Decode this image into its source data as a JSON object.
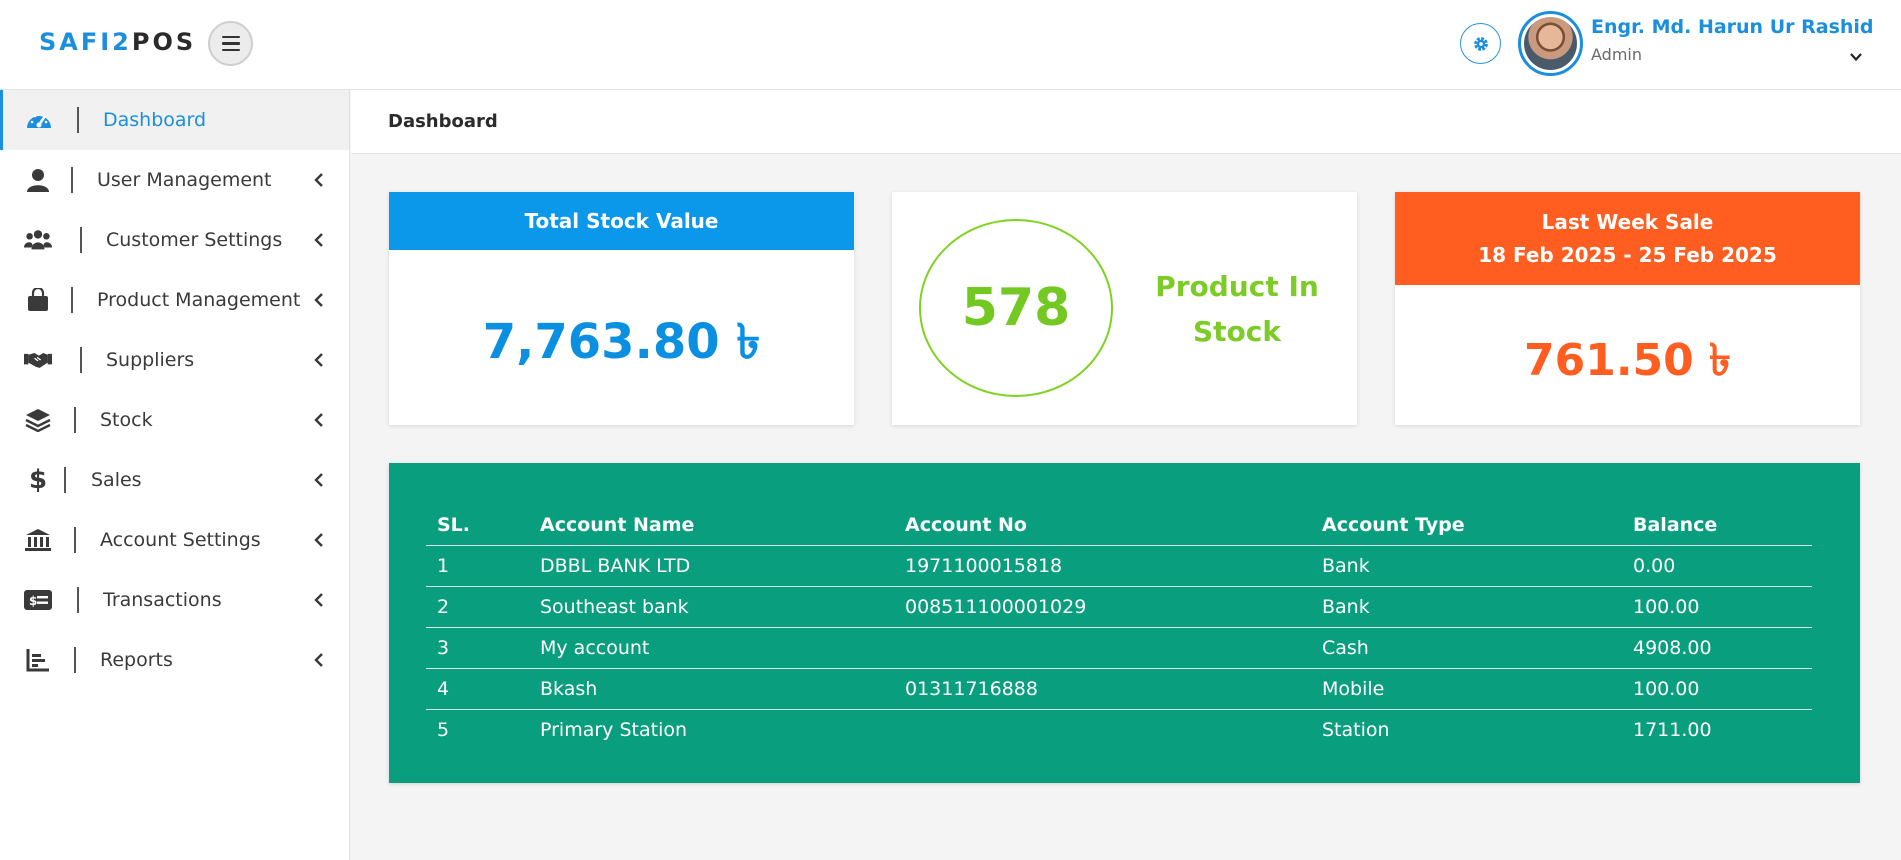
{
  "header": {
    "logo_part1": "SAFI2",
    "logo_part2": "POS",
    "user_name": "Engr. Md. Harun Ur Rashid",
    "user_role": "Admin"
  },
  "sidebar": {
    "items": [
      {
        "label": "Dashboard",
        "icon": "tachometer-icon",
        "active": true
      },
      {
        "label": "User Management",
        "icon": "user-icon"
      },
      {
        "label": "Customer Settings",
        "icon": "users-icon"
      },
      {
        "label": "Product Management",
        "icon": "shopping-bag-icon"
      },
      {
        "label": "Suppliers",
        "icon": "handshake-icon"
      },
      {
        "label": "Stock",
        "icon": "layers-icon"
      },
      {
        "label": "Sales",
        "icon": "dollar-icon"
      },
      {
        "label": "Account Settings",
        "icon": "bank-icon"
      },
      {
        "label": "Transactions",
        "icon": "money-card-icon"
      },
      {
        "label": "Reports",
        "icon": "bar-chart-icon"
      }
    ]
  },
  "breadcrumb": "Dashboard",
  "cards": {
    "stock_value": {
      "title": "Total Stock Value",
      "value": "7,763.80 ৳"
    },
    "products": {
      "count": "578",
      "label": "Product In Stock"
    },
    "last_week": {
      "title": "Last Week Sale",
      "range": "18 Feb 2025 - 25 Feb 2025",
      "value": "761.50 ৳"
    }
  },
  "accounts": {
    "columns": [
      "SL.",
      "Account Name",
      "Account No",
      "Account Type",
      "Balance"
    ],
    "rows": [
      [
        "1",
        "DBBL BANK LTD",
        "1971100015818",
        "Bank",
        "0.00"
      ],
      [
        "2",
        "Southeast bank",
        "008511100001029",
        "Bank",
        "100.00"
      ],
      [
        "3",
        "My account",
        "",
        "Cash",
        "4908.00"
      ],
      [
        "4",
        "Bkash",
        "01311716888",
        "Mobile",
        "100.00"
      ],
      [
        "5",
        "Primary Station",
        "",
        "Station",
        "1711.00"
      ]
    ]
  },
  "colors": {
    "primary": "#1b8fdb",
    "stock_card": "#0b98ea",
    "sale_card": "#ff5e20",
    "product_green": "#7ed321",
    "table_green": "#099e7d"
  }
}
